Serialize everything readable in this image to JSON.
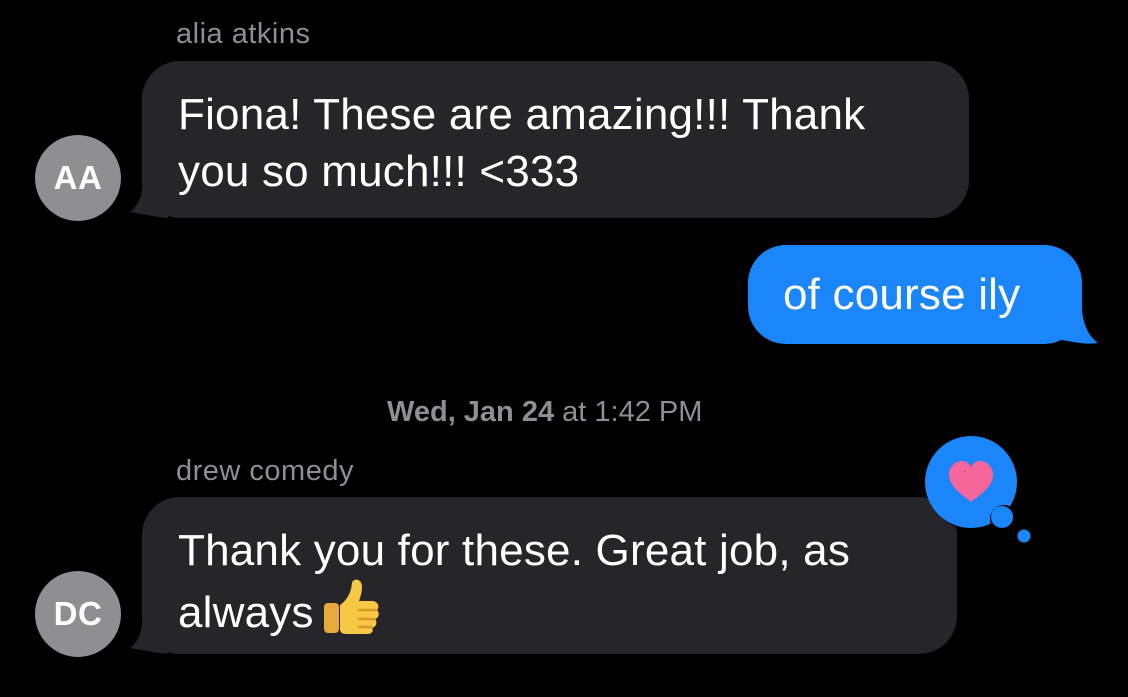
{
  "thread": {
    "message_1": {
      "sender": "alia atkins",
      "avatar_initials": "AA",
      "text": "Fiona! These are amazing!!! Thank you so much!!! <333"
    },
    "message_2": {
      "text": "of course ily"
    },
    "timestamp": {
      "day": "Wed, Jan 24",
      "time": "at 1:42 PM"
    },
    "message_3": {
      "sender": "drew comedy",
      "avatar_initials": "DC",
      "text": "Thank you for these. Great job, as always",
      "emoji_icon": "thumbs-up-icon",
      "reaction_icon": "heart-icon"
    }
  },
  "colors": {
    "background": "#000000",
    "incoming_bubble": "#26252a",
    "outgoing_bubble": "#1a86f9",
    "avatar": "#8e8e93",
    "meta_text": "#8e8e93",
    "reaction_bubble": "#1a86f9",
    "heart": "#f5679a"
  }
}
